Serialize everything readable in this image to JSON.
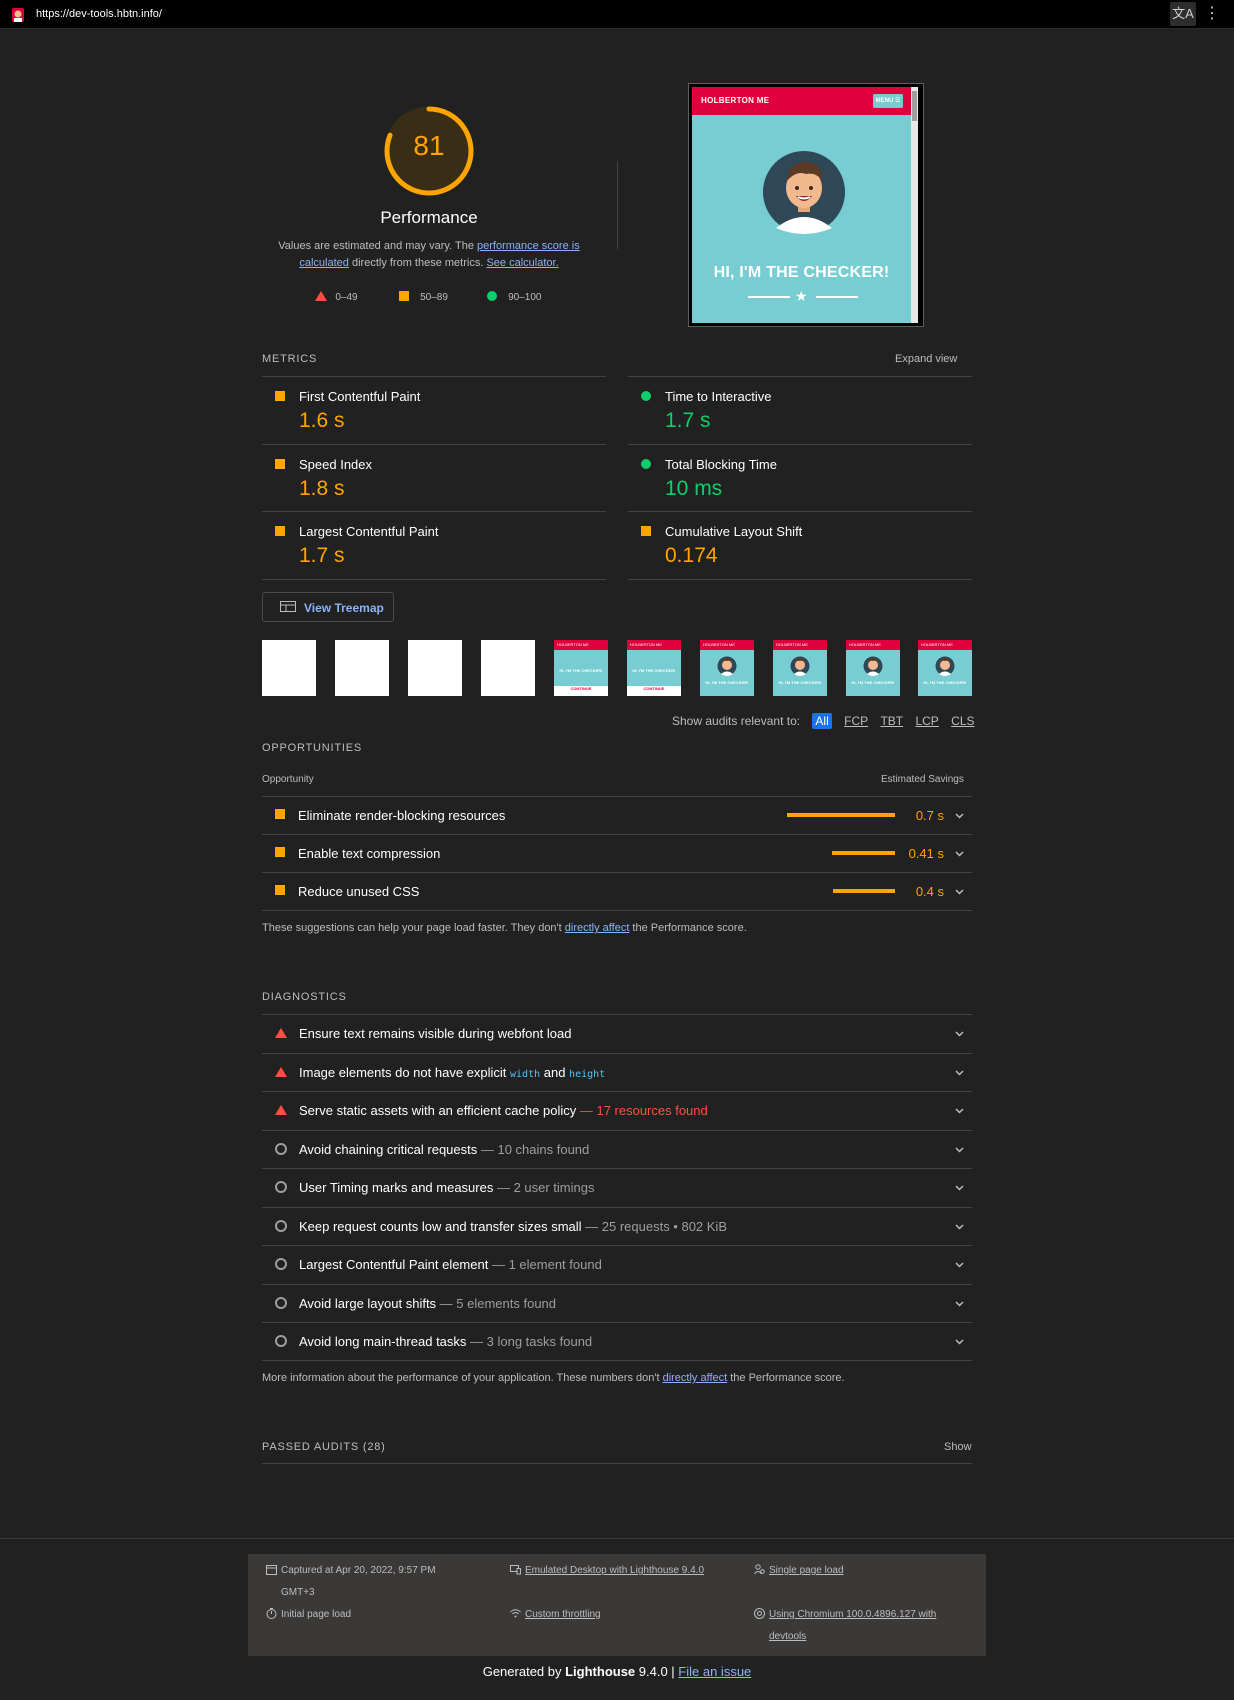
{
  "browser": {
    "url": "https://dev-tools.hbtn.info/",
    "translate_icon": "translate-icon",
    "menu_icon": "more-vert-icon"
  },
  "gauge": {
    "score": "81",
    "title": "Performance",
    "desc_prefix": "Values are estimated and may vary. The ",
    "desc_link1": "performance score is calculated",
    "desc_mid": " directly from these metrics. ",
    "desc_link2": "See calculator.",
    "legend": [
      "0–49",
      "50–89",
      "90–100"
    ],
    "color": "#ffa400"
  },
  "screenshot": {
    "brand": "HOLBERTON ME",
    "menu": "MENU ☰",
    "headline": "HI, I'M THE CHECKER!"
  },
  "metrics": {
    "header": "METRICS",
    "expand": "Expand view",
    "items": [
      {
        "title": "First Contentful Paint",
        "value": "1.6 s",
        "status": "average"
      },
      {
        "title": "Time to Interactive",
        "value": "1.7 s",
        "status": "pass"
      },
      {
        "title": "Speed Index",
        "value": "1.8 s",
        "status": "average"
      },
      {
        "title": "Total Blocking Time",
        "value": "10 ms",
        "status": "pass"
      },
      {
        "title": "Largest Contentful Paint",
        "value": "1.7 s",
        "status": "average"
      },
      {
        "title": "Cumulative Layout Shift",
        "value": "0.174",
        "status": "average"
      }
    ]
  },
  "treemap": {
    "label": "View Treemap"
  },
  "filmstrip": {
    "frame_headline": "HI, I'M THE CHECKER!",
    "frame_header": "HOLBERTON ME",
    "frame_footer": "CONTINUE"
  },
  "filter": {
    "label": "Show audits relevant to:",
    "chips": [
      "All",
      "FCP",
      "TBT",
      "LCP",
      "CLS"
    ]
  },
  "opportunities": {
    "header": "OPPORTUNITIES",
    "col_left": "Opportunity",
    "col_right": "Estimated Savings",
    "items": [
      {
        "title": "Eliminate render-blocking resources",
        "value": "0.7 s",
        "savings_fraction": 0.7
      },
      {
        "title": "Enable text compression",
        "value": "0.41 s",
        "savings_fraction": 0.41
      },
      {
        "title": "Reduce unused CSS",
        "value": "0.4 s",
        "savings_fraction": 0.4
      }
    ],
    "note_prefix": "These suggestions can help your page load faster. They don't ",
    "note_link": "directly affect",
    "note_suffix": " the Performance score."
  },
  "diagnostics": {
    "header": "DIAGNOSTICS",
    "items": [
      {
        "title": "Ensure text remains visible during webfont load",
        "detail": "",
        "status": "fail"
      },
      {
        "title_a": "Image elements do not have explicit ",
        "code1": "width",
        "title_b": " and ",
        "code2": "height",
        "status": "fail"
      },
      {
        "title": "Serve static assets with an efficient cache policy",
        "detail": " — 17 resources found",
        "status": "fail"
      },
      {
        "title": "Avoid chaining critical requests",
        "detail": " — 10 chains found",
        "status": "info"
      },
      {
        "title": "User Timing marks and measures",
        "detail": " — 2 user timings",
        "status": "info"
      },
      {
        "title": "Keep request counts low and transfer sizes small",
        "detail": " — 25 requests • 802 KiB",
        "status": "info"
      },
      {
        "title": "Largest Contentful Paint element",
        "detail": " — 1 element found",
        "status": "info"
      },
      {
        "title": "Avoid large layout shifts",
        "detail": " — 5 elements found",
        "status": "info"
      },
      {
        "title": "Avoid long main-thread tasks",
        "detail": " — 3 long tasks found",
        "status": "info"
      }
    ],
    "note_prefix": "More information about the performance of your application. These numbers don't ",
    "note_link": "directly affect",
    "note_suffix": " the Performance score."
  },
  "passed": {
    "header": "PASSED AUDITS (28)",
    "show": "Show"
  },
  "footer": {
    "captured": "Captured at Apr 20, 2022, 9:57 PM",
    "captured_tz": "GMT+3",
    "initial": "Initial page load",
    "emulated": "Emulated Desktop with Lighthouse 9.4.0",
    "throttling": "Custom throttling",
    "single": "Single page load",
    "chromium": "Using Chromium 100.0.4896.127 with",
    "chromium2": "devtools",
    "gen_prefix": "Generated by ",
    "gen_brand": "Lighthouse",
    "gen_version": " 9.4.0 | ",
    "gen_link": "File an issue"
  },
  "colors": {
    "pass": "#0cce6b",
    "average": "#ffa400",
    "fail": "#ff4e42",
    "background": "#212121"
  }
}
